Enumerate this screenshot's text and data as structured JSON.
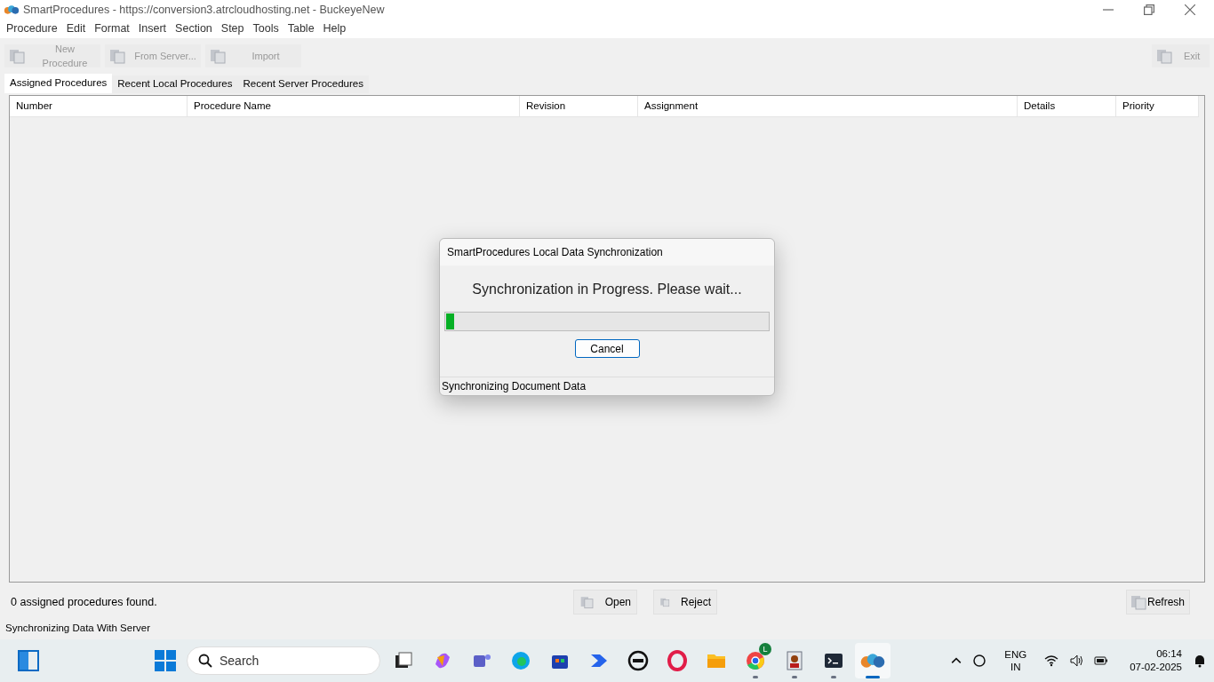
{
  "window": {
    "title": "SmartProcedures - https://conversion3.atrcloudhosting.net - BuckeyeNew"
  },
  "menu": [
    "Procedure",
    "Edit",
    "Format",
    "Insert",
    "Section",
    "Step",
    "Tools",
    "Table",
    "Help"
  ],
  "toolbar": [
    {
      "label": "New Procedure",
      "disabled": true
    },
    {
      "label": "From Server...",
      "disabled": true
    },
    {
      "label": "Import",
      "disabled": true
    }
  ],
  "exit_button": {
    "label": "Exit",
    "disabled": true
  },
  "tabs": [
    {
      "label": "Assigned Procedures",
      "selected": true
    },
    {
      "label": "Recent Local Procedures",
      "selected": false
    },
    {
      "label": "Recent Server Procedures",
      "selected": false
    }
  ],
  "table": {
    "columns": [
      "Number",
      "Procedure Name",
      "Revision",
      "Assignment",
      "Details",
      "Priority"
    ]
  },
  "dialog": {
    "title": "SmartProcedures Local Data Synchronization",
    "message": "Synchronization in Progress.  Please wait...",
    "progress": {
      "level": 0.025
    },
    "cancel": "Cancel",
    "status": "Synchronizing Document Data"
  },
  "footer": {
    "count": "0 assigned procedures found.",
    "open": "Open",
    "reject": "Reject",
    "refresh": "Refresh"
  },
  "status_bar": "Synchronizing Data With Server",
  "taskbar": {
    "search": "Search",
    "apps": [
      {
        "kind": "taskview",
        "running": false,
        "selected": false
      },
      {
        "kind": "copilot",
        "running": false,
        "selected": false
      },
      {
        "kind": "teams",
        "running": false,
        "selected": false
      },
      {
        "kind": "edge",
        "running": false,
        "selected": false
      },
      {
        "kind": "store",
        "running": false,
        "selected": false
      },
      {
        "kind": "automate",
        "running": false,
        "selected": false
      },
      {
        "kind": "dell",
        "running": false,
        "selected": false
      },
      {
        "kind": "opera",
        "running": false,
        "selected": false
      },
      {
        "kind": "folder",
        "running": false,
        "selected": false
      },
      {
        "kind": "chrome",
        "running": true,
        "selected": false,
        "badge": "L"
      },
      {
        "kind": "contacts",
        "running": true,
        "selected": false
      },
      {
        "kind": "terminal",
        "running": true,
        "selected": false
      },
      {
        "kind": "smartprocedures",
        "running": true,
        "selected": true
      }
    ],
    "language": "ENG",
    "region": "IN",
    "time": "06:14",
    "date": "07-02-2025"
  }
}
